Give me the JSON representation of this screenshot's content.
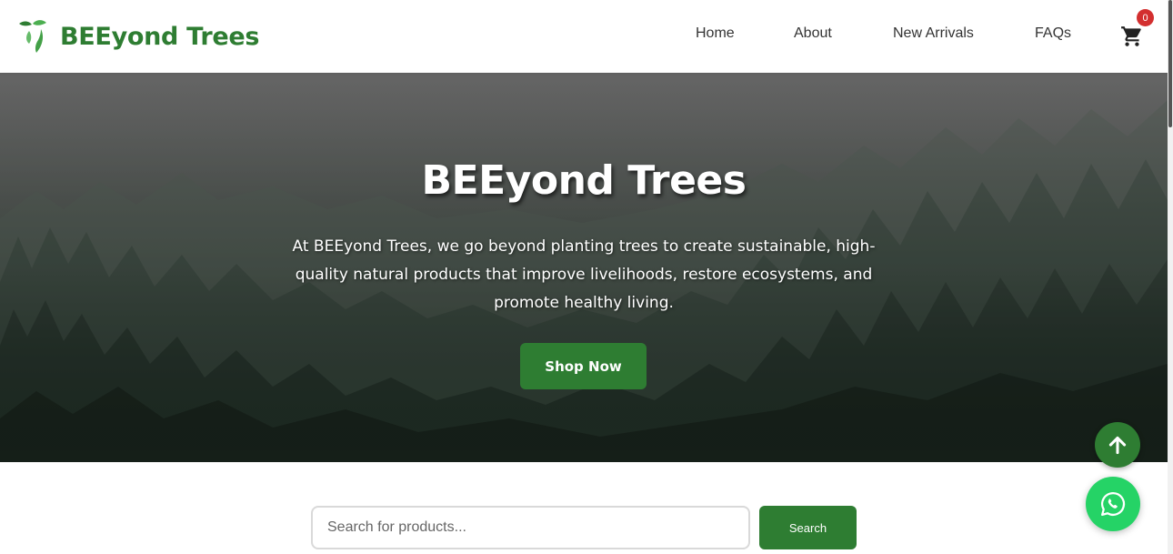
{
  "brand": {
    "name": "BEEyond Trees",
    "logo_icon": "leaf-logo-icon",
    "color": "#2e7d32"
  },
  "nav": {
    "links": [
      {
        "label": "Home"
      },
      {
        "label": "About"
      },
      {
        "label": "New Arrivals"
      },
      {
        "label": "FAQs"
      }
    ],
    "cart_icon": "cart-icon",
    "cart_count": "0"
  },
  "hero": {
    "title": "BEEyond Trees",
    "description": "At BEEyond Trees, we go beyond planting trees to create sustainable, high-quality natural products that improve livelihoods, restore ecosystems, and promote healthy living.",
    "cta_label": "Shop Now"
  },
  "search": {
    "placeholder": "Search for products...",
    "value": "",
    "button_label": "Search"
  },
  "floating": {
    "back_to_top_icon": "arrow-up-icon",
    "whatsapp_icon": "whatsapp-icon",
    "whatsapp_color": "#25d366"
  },
  "colors": {
    "accent": "#2e7d32",
    "badge": "#d32f2f"
  }
}
